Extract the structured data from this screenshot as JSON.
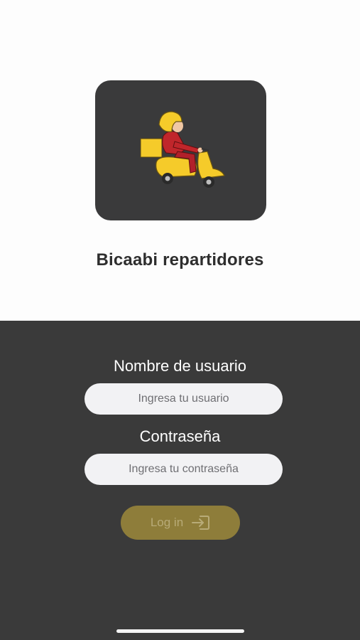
{
  "app": {
    "title": "Bicaabi repartidores",
    "logo_icon": "delivery-scooter-icon"
  },
  "form": {
    "username_label": "Nombre de usuario",
    "username_placeholder": "Ingresa tu usuario",
    "username_value": "",
    "password_label": "Contraseña",
    "password_placeholder": "Ingresa tu contraseña",
    "password_value": "",
    "login_label": "Log in",
    "login_icon": "login-arrow-icon"
  },
  "colors": {
    "logo_background": "#3a3a3b",
    "panel_background": "#3a3a3a",
    "login_button": "#8e7d3a",
    "scooter_yellow": "#f5cb2a",
    "rider_red": "#c0262b"
  }
}
